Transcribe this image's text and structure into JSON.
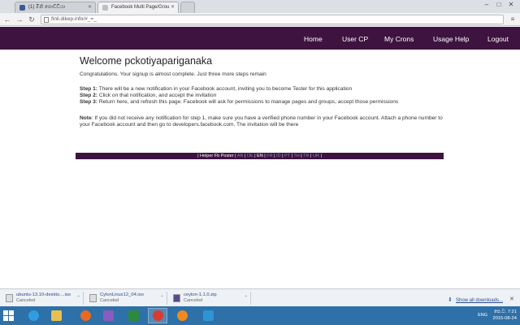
{
  "browser": {
    "tabs": [
      {
        "title": "(1) මිනි පොඩ්ඩියා",
        "active": false
      },
      {
        "title": "Facebook Multi Page/Grou",
        "active": true
      },
      {
        "title": "",
        "active": false
      }
    ],
    "url": "finli.dikep.info/#_=_"
  },
  "site": {
    "nav": [
      "Home",
      "User CP",
      "My Crons",
      "Usage Help",
      "Logout"
    ],
    "welcome": "Welcome pckotiyapariganaka",
    "intro": "Congratulations. Your signup is almost complete. Just three more steps remain",
    "steps": [
      {
        "label": "Step 1:",
        "text": " There will be a new notification in your Facebook account, inviting you to become Tester for this application"
      },
      {
        "label": "Step 2:",
        "text": " Click on that notification, and accept the invitation"
      },
      {
        "label": "Step 3:",
        "text": " Return here, and refresh this page. Facebook will ask for permissions to manage pages and groups, accept those permissions"
      }
    ],
    "note_label": "Note",
    "note_text": ": If you did not receive any notification for step 1, make sure you have a verified phone number in your Facebook account. Attach a phone number to your Facebook account and then go to developers.facebook.com. The invitation will be there",
    "footer_title": "| Helper Fb Poster |",
    "languages": [
      "AR",
      "DE",
      "EN",
      "FR",
      "ID",
      "PT",
      "TH",
      "TR",
      "UR"
    ],
    "current_language": "EN"
  },
  "downloads": {
    "items": [
      {
        "name": "ubuntu-13.10-deskto....iso",
        "status": "Canceled"
      },
      {
        "name": "CylonLinux12_04.iso",
        "status": "Canceled"
      },
      {
        "name": "ceylon-1.1.0.zip",
        "status": "Canceled"
      }
    ],
    "show_all": "Show all downloads..."
  },
  "taskbar": {
    "lang": "ENG",
    "time": "පෙ.ව. 7:21",
    "date": "2015-08-24"
  },
  "colors": {
    "nav_bg": "#3e1340",
    "taskbar_bg": "#2e70a8"
  }
}
